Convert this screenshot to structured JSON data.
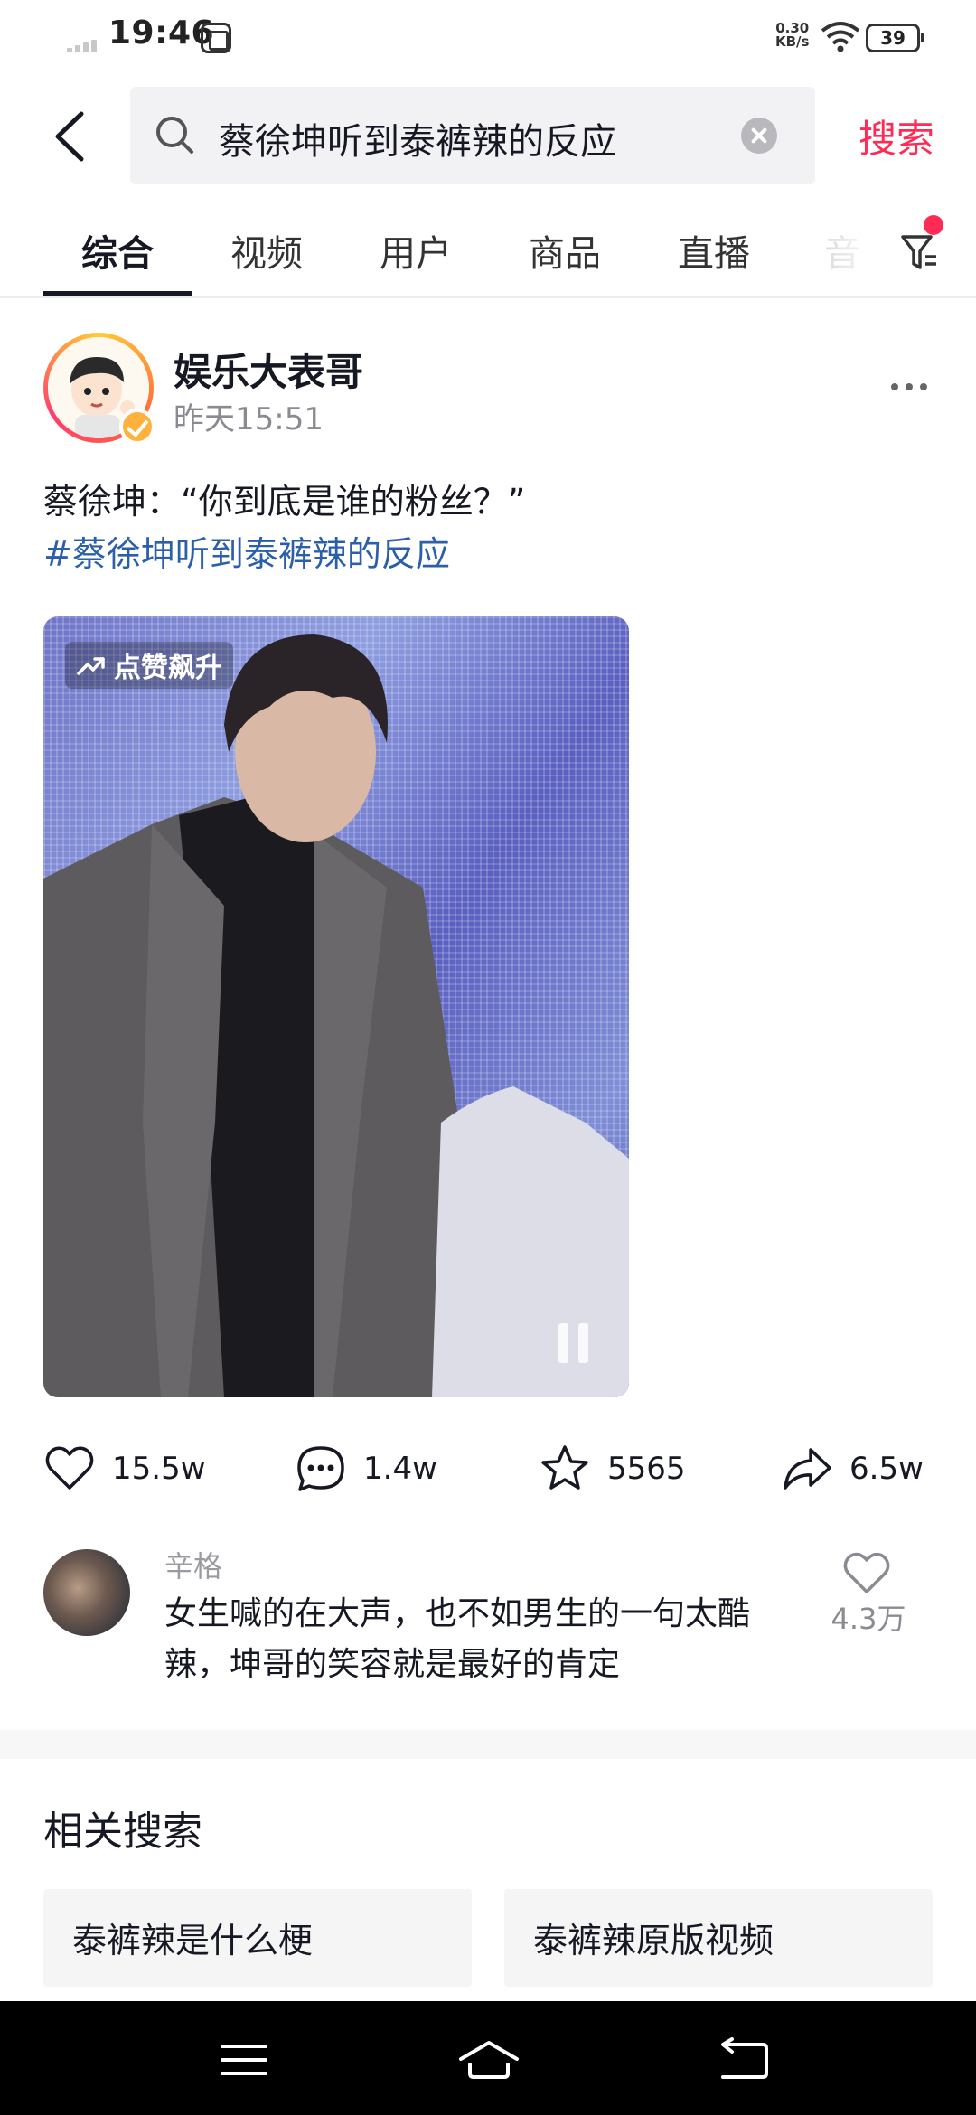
{
  "status_bar": {
    "time": "19:46",
    "net_speed_value": "0.30",
    "net_speed_unit": "KB/s",
    "battery": "39"
  },
  "search": {
    "query": "蔡徐坤听到泰裤辣的反应",
    "submit_label": "搜索"
  },
  "tabs": [
    {
      "label": "综合"
    },
    {
      "label": "视频"
    },
    {
      "label": "用户"
    },
    {
      "label": "商品"
    },
    {
      "label": "直播"
    },
    {
      "label": "音"
    }
  ],
  "post": {
    "author": "娱乐大表哥",
    "time": "昨天15:51",
    "caption": "蔡徐坤：“你到底是谁的粉丝？”",
    "hashtag": "#蔡徐坤听到泰裤辣的反应",
    "video_badge": "点赞飙升",
    "likes": "15.5w",
    "comments": "1.4w",
    "favorites": "5565",
    "shares": "6.5w"
  },
  "top_comment": {
    "user": "辛格",
    "text": "女生喊的在大声，也不如男生的一句太酷辣，坤哥的笑容就是最好的肯定",
    "likes": "4.3万"
  },
  "related": {
    "title": "相关搜索",
    "items": [
      "泰裤辣是什么梗",
      "泰裤辣原版视频"
    ]
  },
  "colors": {
    "accent": "#fe2c55",
    "hashtag": "#2b5fa8",
    "verified": "#ffb13d"
  }
}
